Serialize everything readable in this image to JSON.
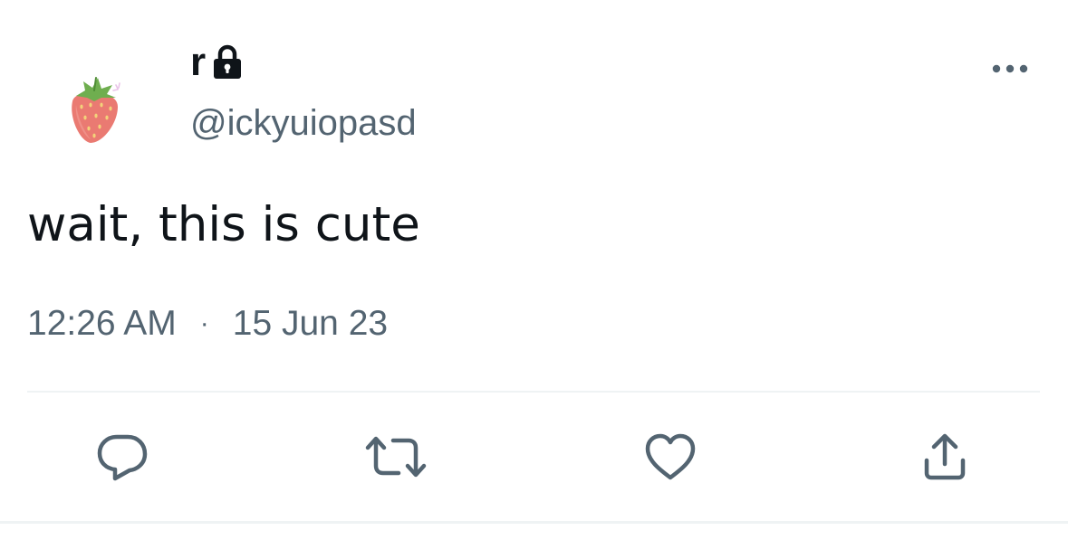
{
  "tweet": {
    "display_name": "r",
    "handle": "@ickyuiopasd",
    "text": "wait, this is cute",
    "time": "12:26 AM",
    "separator": "·",
    "date": "15 Jun 23"
  },
  "icons": {
    "avatar": "strawberry-avatar",
    "lock": "lock-icon",
    "more": "more-icon",
    "reply": "reply-icon",
    "retweet": "retweet-icon",
    "like": "like-icon",
    "share": "share-icon"
  },
  "colors": {
    "text_primary": "#0f1419",
    "text_secondary": "#536471",
    "divider": "#eff3f4",
    "strawberry": "#e8706a"
  }
}
